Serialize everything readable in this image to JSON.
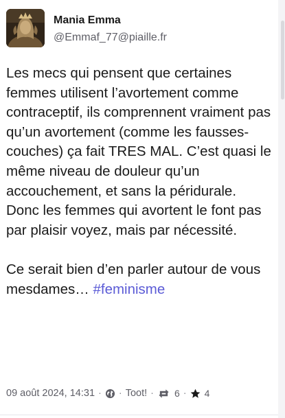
{
  "post": {
    "author": {
      "display_name": "Mania Emma",
      "handle": "@Emmaf_77@piaille.fr"
    },
    "content": {
      "paragraph_1": "Les mecs qui pensent que certaines femmes utilisent l’avortement comme contraceptif, ils comprennent vraiment pas qu’un avortement (comme les fausses-couches) ça fait TRES MAL. C’est quasi le même niveau de douleur qu’un accouchement, et sans la péridurale.",
      "paragraph_2": "Donc les femmes qui avortent le font pas par plaisir voyez, mais par nécessité.",
      "paragraph_3_text": "Ce serait bien d’en parler autour de vous mesdames… ",
      "hashtag": "#feminisme"
    },
    "meta": {
      "timestamp": "09 août 2024, 14:31",
      "separator": "·",
      "visibility_icon": "globe-icon",
      "app": "Toot!",
      "boost_icon": "boost-icon",
      "boosts": "6",
      "favourite_icon": "star-icon",
      "favourites": "4"
    }
  },
  "colors": {
    "text": "#1a1a1a",
    "muted": "#5e5e66",
    "hashtag": "#5b5bd6",
    "border": "#e6e6ea"
  }
}
